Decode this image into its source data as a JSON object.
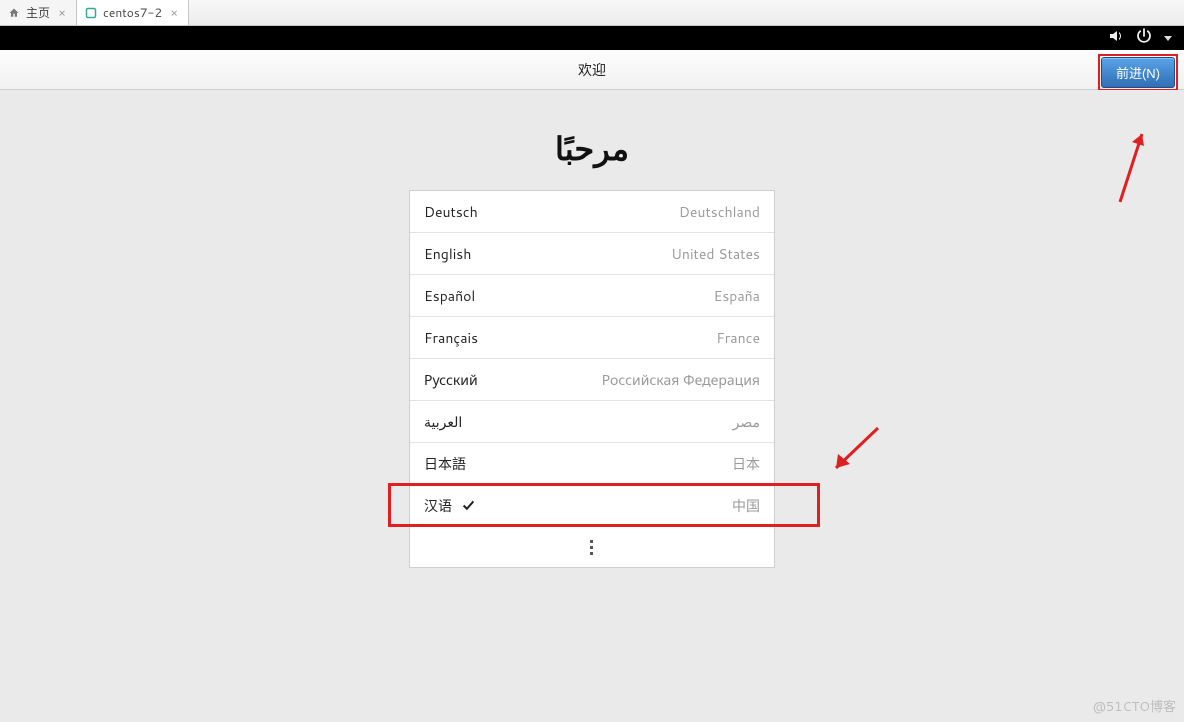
{
  "tabs": {
    "home": "主页",
    "vm": "centos7-2"
  },
  "gnome": {
    "header_title": "欢迎",
    "forward_button": "前进(N)",
    "welcome_script": "مرحبًا"
  },
  "languages": [
    {
      "name": "Deutsch",
      "country": "Deutschland",
      "selected": false
    },
    {
      "name": "English",
      "country": "United States",
      "selected": false
    },
    {
      "name": "Español",
      "country": "España",
      "selected": false
    },
    {
      "name": "Français",
      "country": "France",
      "selected": false
    },
    {
      "name": "Русский",
      "country": "Российская Федерация",
      "selected": false
    },
    {
      "name": "العربية",
      "country": "مصر",
      "selected": false,
      "rtl": true
    },
    {
      "name": "日本語",
      "country": "日本",
      "selected": false
    },
    {
      "name": "汉语",
      "country": "中国",
      "selected": true
    }
  ],
  "watermark": "@51CTO博客"
}
